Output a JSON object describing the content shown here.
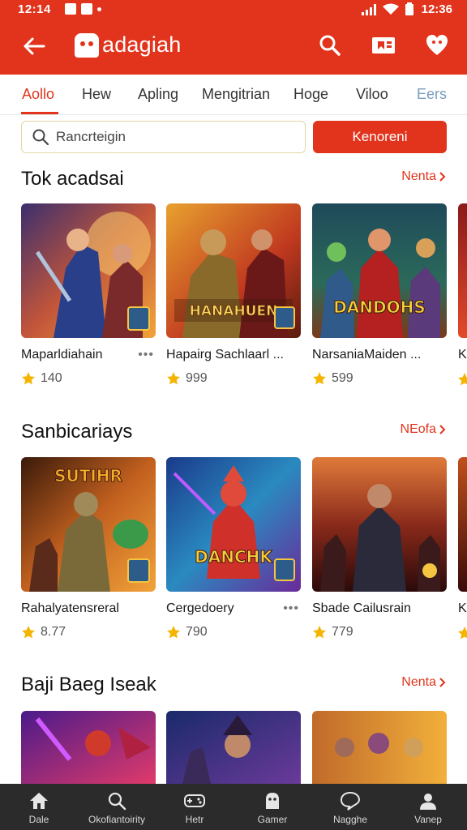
{
  "status_bar": {
    "time_left": "12:14",
    "time_right": "12:36"
  },
  "app_bar": {
    "brand": "adagiah",
    "actions": [
      "search-icon",
      "book-icon",
      "heart-icon"
    ]
  },
  "tabs": [
    {
      "label": "Aollo",
      "active": true
    },
    {
      "label": "Hew",
      "active": false
    },
    {
      "label": "Apling",
      "active": false
    },
    {
      "label": "Mengitrian",
      "active": false
    },
    {
      "label": "Hoge",
      "active": false
    },
    {
      "label": "Viloo",
      "active": false
    },
    {
      "label": "Eers",
      "active": false
    }
  ],
  "search": {
    "placeholder": "Rancrteigin",
    "button_label": "Kenoreni"
  },
  "sections": [
    {
      "title": "Tok acadsai",
      "more": "Nenta",
      "cards": [
        {
          "title": "Maparldiahain",
          "rating": "140"
        },
        {
          "title": "Hapairg Sachlaarl ...",
          "rating": "999",
          "art_text": "HANAHUEN"
        },
        {
          "title": "NarsaniaMaiden ...",
          "rating": "599",
          "art_text": "DANDOHS"
        }
      ],
      "peek_label": "K"
    },
    {
      "title": "Sanbicariays",
      "more": "NEofa",
      "cards": [
        {
          "title": "Rahalyatensreral",
          "rating": "8.77",
          "art_text": "SUTIHR"
        },
        {
          "title": "Cergedoery",
          "rating": "790",
          "art_text": "DANCHK"
        },
        {
          "title": "Sbade Cailusrain",
          "rating": "779"
        }
      ],
      "peek_label": "K"
    },
    {
      "title": "Baji Baeg Iseak",
      "more": "Nenta",
      "cards": []
    }
  ],
  "bottom_nav": [
    {
      "label": "Dale",
      "icon": "home-icon"
    },
    {
      "label": "Okofiantoirity",
      "icon": "search-icon"
    },
    {
      "label": "Hetr",
      "icon": "gamepad-icon"
    },
    {
      "label": "Gamer",
      "icon": "bag-icon"
    },
    {
      "label": "Nagghe",
      "icon": "chat-icon"
    },
    {
      "label": "Vanep",
      "icon": "user-icon"
    }
  ],
  "colors": {
    "primary": "#e2341d",
    "star": "#f5b400",
    "nav_bg": "#2b2b2b"
  }
}
